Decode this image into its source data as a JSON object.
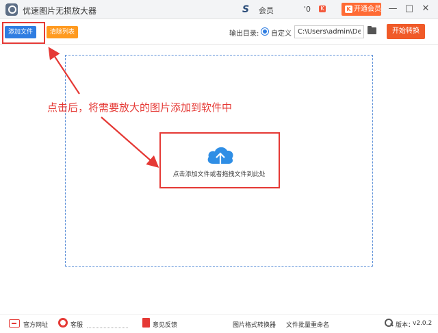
{
  "titlebar": {
    "title": "优速图片无损放大器",
    "partial_text1": "会员",
    "partial_text2": "'0",
    "red_mini": "K",
    "vip_label": "开通会员",
    "vip_icon_glyph": "K",
    "minimize": "—",
    "maximize": "□",
    "close": "✕"
  },
  "toolbar": {
    "add_file": "添加文件",
    "clear_list": "清除列表",
    "output_label": "输出目录:",
    "radio_label": "自定义",
    "path_value": "C:\\Users\\admin\\Deskto",
    "start_convert": "开始转换"
  },
  "main": {
    "annotation": "点击后，将需要放大的图片添加到软件中",
    "drop_hint": "点击添加文件或者拖拽文件到此处"
  },
  "footer": {
    "website": "官方网址",
    "support": "客服",
    "feedback": "意见反馈",
    "format_converter": "图片格式转换器",
    "batch_rename": "文件批量重命名",
    "version_label": "版本：",
    "version_value": "v2.0.2"
  },
  "colors": {
    "accent_blue": "#2f7de1",
    "orange": "#ff9a1f",
    "start_red": "#f05a28",
    "annotation_red": "#e53935"
  }
}
